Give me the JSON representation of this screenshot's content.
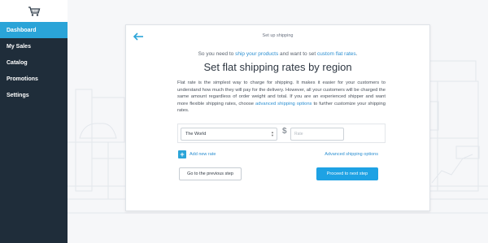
{
  "sidebar": {
    "logo_icon": "shopping-cart-icon",
    "items": [
      {
        "label": "Dashboard",
        "active": true
      },
      {
        "label": "My Sales",
        "active": false
      },
      {
        "label": "Catalog",
        "active": false
      },
      {
        "label": "Promotions",
        "active": false
      },
      {
        "label": "Settings",
        "active": false
      }
    ]
  },
  "card": {
    "title": "Set up shipping",
    "intro_prefix": "So you need to ",
    "intro_link1": "ship your products",
    "intro_middle": " and want to set ",
    "intro_link2": "custom flat rates",
    "intro_suffix": ".",
    "heading": "Set flat shipping rates by region",
    "description": "Flat rate is the simplest way to charge for shipping. It makes it easier for your customers to understand how much they will pay for the delivery. However, all your customers will be charged the same amount regardless of order weight and total. If you are an experienced shipper and want more flexible shipping rates, choose ",
    "description_link": "advanced shipping options",
    "description_suffix": " to further customize your shipping rates.",
    "region_value": "The World",
    "currency_symbol": "$",
    "rate_placeholder": "Rate",
    "add_rate_label": "Add new rate",
    "advanced_link": "Advanced shipping options",
    "prev_button": "Go to the previous step",
    "next_button": "Proceed to next step"
  },
  "colors": {
    "sidebar_bg": "#1f2d3a",
    "accent": "#2aa4d8",
    "primary_button": "#1ea2e4",
    "link": "#2c8fd1"
  }
}
